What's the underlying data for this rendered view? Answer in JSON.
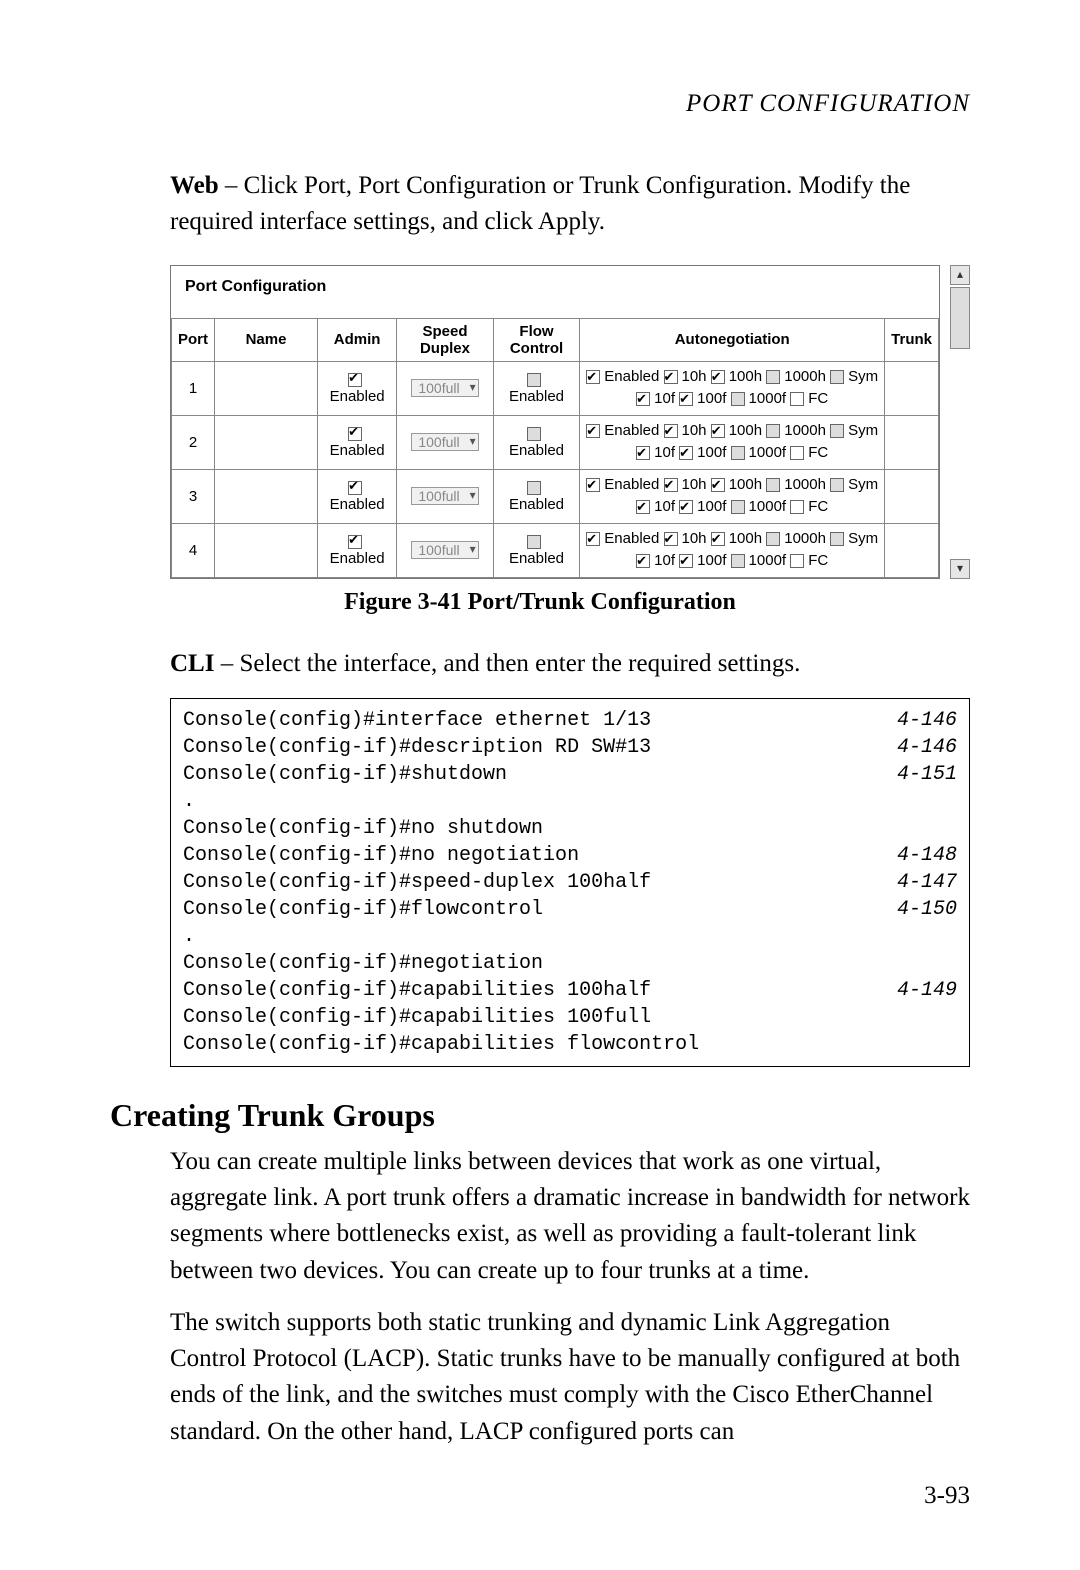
{
  "running_head": "PORT CONFIGURATION",
  "intro_bold": "Web",
  "intro_text": " – Click Port, Port Configuration or Trunk Configuration. Modify the required interface settings, and click Apply.",
  "screenshot": {
    "title": "Port Configuration",
    "headers": [
      "Port",
      "Name",
      "Admin",
      "Speed Duplex",
      "Flow Control",
      "Autonegotiation",
      "Trunk"
    ],
    "admin_label": "Enabled",
    "speed_value": "100full",
    "flow_label": "Enabled",
    "autoneg": {
      "row1": [
        {
          "label": "Enabled",
          "checked": true
        },
        {
          "label": "10h",
          "checked": true
        },
        {
          "label": "100h",
          "checked": true
        },
        {
          "label": "1000h",
          "checked": false,
          "grey": true
        },
        {
          "label": "Sym",
          "checked": false,
          "grey": true
        }
      ],
      "row2": [
        {
          "label": "10f",
          "checked": true
        },
        {
          "label": "100f",
          "checked": true
        },
        {
          "label": "1000f",
          "checked": false,
          "grey": true
        },
        {
          "label": "FC",
          "checked": false
        }
      ]
    },
    "ports": [
      "1",
      "2",
      "3",
      "4"
    ]
  },
  "figure_caption": "Figure 3-41  Port/Trunk Configuration",
  "cli_intro_bold": "CLI",
  "cli_intro_text": " – Select the interface, and then enter the required settings.",
  "cli_lines": [
    {
      "cmd": "Console(config)#interface ethernet 1/13",
      "ref": "4-146"
    },
    {
      "cmd": "Console(config-if)#description RD SW#13",
      "ref": "4-146"
    },
    {
      "cmd": "Console(config-if)#shutdown",
      "ref": "4-151"
    },
    {
      "cmd": ".",
      "ref": ""
    },
    {
      "cmd": "Console(config-if)#no shutdown",
      "ref": ""
    },
    {
      "cmd": "Console(config-if)#no negotiation",
      "ref": "4-148"
    },
    {
      "cmd": "Console(config-if)#speed-duplex 100half",
      "ref": "4-147"
    },
    {
      "cmd": "Console(config-if)#flowcontrol",
      "ref": "4-150"
    },
    {
      "cmd": ".",
      "ref": ""
    },
    {
      "cmd": "Console(config-if)#negotiation",
      "ref": ""
    },
    {
      "cmd": "Console(config-if)#capabilities 100half",
      "ref": "4-149"
    },
    {
      "cmd": "Console(config-if)#capabilities 100full",
      "ref": ""
    },
    {
      "cmd": "Console(config-if)#capabilities flowcontrol",
      "ref": ""
    }
  ],
  "heading": "Creating Trunk Groups",
  "body1": "You can create multiple links between devices that work as one virtual, aggregate link. A port trunk offers a dramatic increase in bandwidth for network segments where bottlenecks exist, as well as providing a fault-tolerant link between two devices. You can create up to four trunks at a time.",
  "body2": "The switch supports both static trunking and dynamic Link Aggregation Control Protocol (LACP). Static trunks have to be manually configured at both ends of the link, and the switches must comply with the Cisco EtherChannel standard. On the other hand, LACP configured ports can",
  "page_number": "3-93"
}
